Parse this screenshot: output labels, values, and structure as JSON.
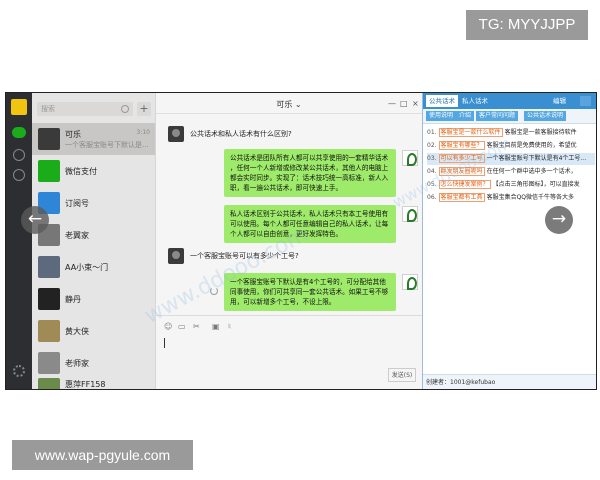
{
  "overlays": {
    "tg": "TG: MYYJJPP",
    "site": "www.wap-pgyule.com",
    "watermark": "www.ddooo.com"
  },
  "list": {
    "search_placeholder": "搜索",
    "plus": "+",
    "chats": [
      {
        "name": "可乐",
        "preview": "一个客服宝账号下默认是...",
        "time": "3:10"
      },
      {
        "name": "微信支付",
        "preview": "",
        "time": ""
      },
      {
        "name": "订阅号",
        "preview": "",
        "time": ""
      },
      {
        "name": "老翼家",
        "preview": "",
        "time": ""
      },
      {
        "name": "AA小束～门",
        "preview": "",
        "time": ""
      },
      {
        "name": "静丹",
        "preview": "",
        "time": ""
      },
      {
        "name": "黄大侠",
        "preview": "",
        "time": ""
      },
      {
        "name": "老师家",
        "preview": "",
        "time": ""
      },
      {
        "name": "惠萍FF158",
        "preview": "",
        "time": ""
      }
    ]
  },
  "chat": {
    "title": "可乐 ⌄",
    "messages": [
      {
        "from": "other",
        "text": "公共话术和私人话术有什么区别?"
      },
      {
        "from": "me",
        "lines": [
          "公共话术是团队所有人都可以共享使用的一套精华话术",
          "，任何一个人新增或修改某公共话术，其他人的电脑上",
          "都会实时同步。实现了：话术技巧统一高标准，新人入",
          "职，看一遍公共话术，即可快速上手。"
        ]
      },
      {
        "from": "me",
        "lines": [
          "私人话术区别于公共话术，私人话术只有本工号使用有",
          "可以使用。每个人都可任意编辑自己的私人话术，让每",
          "个人都可以自由创意，更好发挥特色。"
        ]
      },
      {
        "from": "other",
        "text": "一个客服宝账号可以有多少个工号?"
      },
      {
        "from": "me",
        "lines": [
          "一个客服宝账号下默认是有4个工号的，可分配给其他",
          "同事使用，你们可共享同一套公共话术。如果工号不够",
          "用，可以新增多个工号，不设上限。"
        ]
      }
    ],
    "send_label": "发送(S)"
  },
  "panel": {
    "tabs": [
      "公共话术",
      "私人话术"
    ],
    "edit_label": "编辑",
    "buttons": [
      "使用说明",
      "介绍",
      "客户常问问题",
      "公共话术说明"
    ],
    "items": [
      {
        "no": "01.",
        "tag": "客服宝是一款什么软件",
        "text": "客服宝是一款客服接待软件"
      },
      {
        "no": "02.",
        "tag": "客服宝有哪些？",
        "text": "客服宝目前是免费使用的，希望优"
      },
      {
        "no": "03.",
        "tag": "可以有多少工号",
        "text": "一个客服宝账号下默认是有4个工号..."
      },
      {
        "no": "04.",
        "tag": "群发朋友圈呢吗",
        "text": "在任何一个群中选中多一个话术，"
      },
      {
        "no": "05.",
        "tag": "怎么快捷发案例？",
        "text": "【点击三角形图标】，可以直接发"
      },
      {
        "no": "06.",
        "tag": "客服宝都有工具",
        "text": "客服宝集合QQ微信千牛等各大多"
      }
    ],
    "footer": "创建者：1001@kefubao"
  }
}
